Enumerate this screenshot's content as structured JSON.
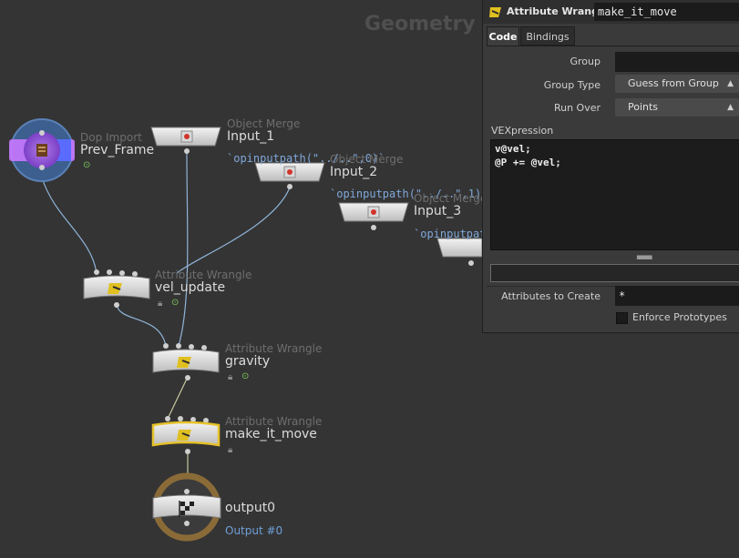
{
  "network": {
    "context_label": "Geometry",
    "nodes": [
      {
        "id": "prev_frame",
        "type": "Dop Import",
        "name": "Prev_Frame"
      },
      {
        "id": "input_1",
        "type": "Object Merge",
        "name": "Input_1",
        "expr": "`opinputpath(\"../..\",0)`"
      },
      {
        "id": "input_2",
        "type": "Object Merge",
        "name": "Input_2",
        "expr": "`opinputpath(\"../..\",1)`"
      },
      {
        "id": "input_3",
        "type": "Object Merge",
        "name": "Input_3",
        "expr": "`opinputpat"
      },
      {
        "id": "vel_update",
        "type": "Attribute Wrangle",
        "name": "vel_update"
      },
      {
        "id": "gravity",
        "type": "Attribute Wrangle",
        "name": "gravity"
      },
      {
        "id": "make_it_move",
        "type": "Attribute Wrangle",
        "name": "make_it_move",
        "selected": true
      },
      {
        "id": "output0",
        "type": "Output",
        "name": "output0",
        "output_label": "Output #0"
      }
    ]
  },
  "params": {
    "node_type": "Attribute Wrangle",
    "node_name": "make_it_move",
    "tabs": [
      {
        "label": "Code",
        "active": true
      },
      {
        "label": "Bindings",
        "active": false
      }
    ],
    "group_label": "Group",
    "group_value": "",
    "group_type_label": "Group Type",
    "group_type_value": "Guess from Group",
    "run_over_label": "Run Over",
    "run_over_value": "Points",
    "vex_label": "VEXpression",
    "vex_lines": [
      "v@vel;",
      "@P += @vel;"
    ],
    "attrs_label": "Attributes to Create",
    "attrs_value": "*",
    "enforce_label": "Enforce Prototypes",
    "enforce_checked": false
  },
  "colors": {
    "background": "#343434",
    "wire": "#8fb4d8",
    "selected_outline": "#e6c229",
    "display_flag": "#7ccb5a",
    "dop_node": "#9b5bd6",
    "output_ring": "#8a6b38"
  },
  "icons": {
    "wrangle": "wrangle-icon",
    "object_merge": "object-merge-icon",
    "dop_import": "dop-import-icon",
    "output": "checkered-flag-icon",
    "lock": "lock-icon",
    "display": "display-flag-icon"
  }
}
